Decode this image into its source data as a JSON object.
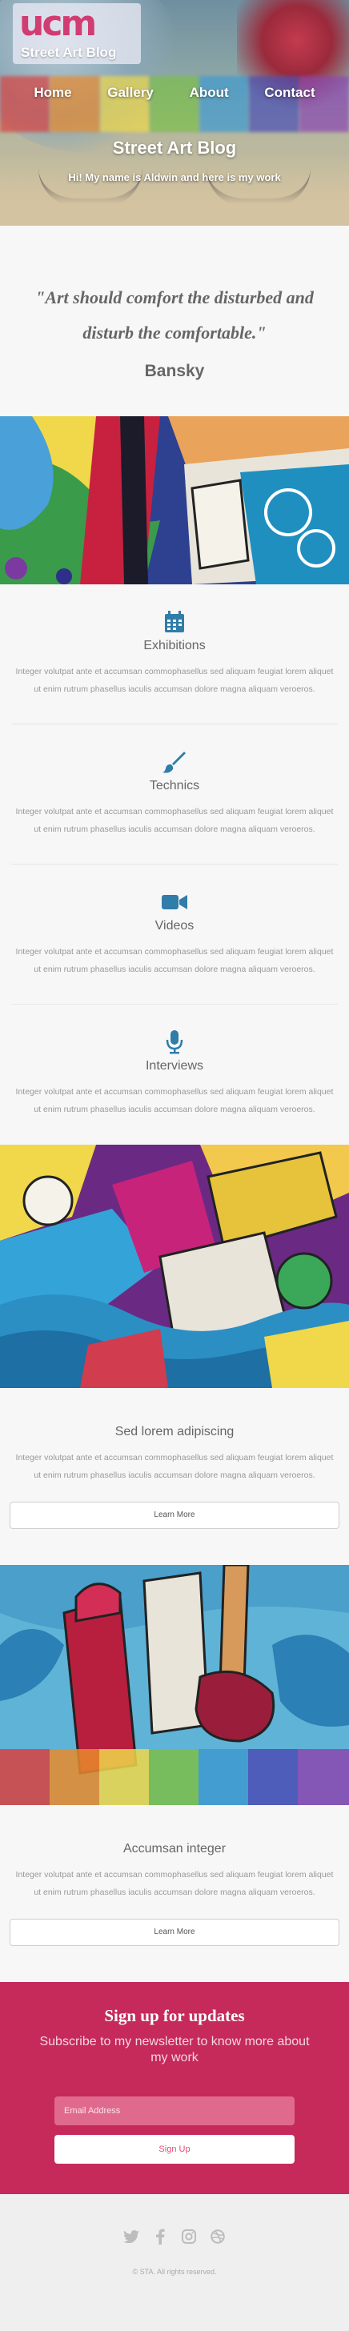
{
  "brand": {
    "mark": "ucm",
    "name": "Street Art Blog"
  },
  "nav": {
    "items": [
      {
        "label": "Home"
      },
      {
        "label": "Gallery"
      },
      {
        "label": "About"
      },
      {
        "label": "Contact"
      }
    ]
  },
  "hero": {
    "title": "Street Art Blog",
    "subtitle": "Hi! My name is Aldwin and here is my work"
  },
  "quote": {
    "text": "\"Art should comfort the disturbed and disturb the comfortable.\"",
    "author": "Bansky"
  },
  "features": [
    {
      "icon": "calendar-icon",
      "title": "Exhibitions",
      "text": "Integer volutpat ante et accumsan commophasellus sed aliquam feugiat lorem aliquet ut enim rutrum phasellus iaculis accumsan dolore magna aliquam veroeros."
    },
    {
      "icon": "brush-icon",
      "title": "Technics",
      "text": "Integer volutpat ante et accumsan commophasellus sed aliquam feugiat lorem aliquet ut enim rutrum phasellus iaculis accumsan dolore magna aliquam veroeros."
    },
    {
      "icon": "video-camera-icon",
      "title": "Videos",
      "text": "Integer volutpat ante et accumsan commophasellus sed aliquam feugiat lorem aliquet ut enim rutrum phasellus iaculis accumsan dolore magna aliquam veroeros."
    },
    {
      "icon": "microphone-icon",
      "title": "Interviews",
      "text": "Integer volutpat ante et accumsan commophasellus sed aliquam feugiat lorem aliquet ut enim rutrum phasellus iaculis accumsan dolore magna aliquam veroeros."
    }
  ],
  "posts": [
    {
      "title": "Sed lorem adipiscing",
      "text": "Integer volutpat ante et accumsan commophasellus sed aliquam feugiat lorem aliquet ut enim rutrum phasellus iaculis accumsan dolore magna aliquam veroeros.",
      "button": "Learn More"
    },
    {
      "title": "Accumsan integer",
      "text": "Integer volutpat ante et accumsan commophasellus sed aliquam feugiat lorem aliquet ut enim rutrum phasellus iaculis accumsan dolore magna aliquam veroeros.",
      "button": "Learn More"
    }
  ],
  "signup": {
    "title": "Sign up for updates",
    "subtitle": "Subscribe to my newsletter to know more about my work",
    "email_placeholder": "Email Address",
    "button": "Sign Up"
  },
  "footer": {
    "social_icons": [
      "twitter-icon",
      "facebook-icon",
      "instagram-icon",
      "dribbble-icon"
    ],
    "copyright": "© STA. All rights reserved."
  },
  "colors": {
    "accent": "#c52a5a",
    "icon_blue": "#2f7da8",
    "text_gray": "#666666"
  }
}
